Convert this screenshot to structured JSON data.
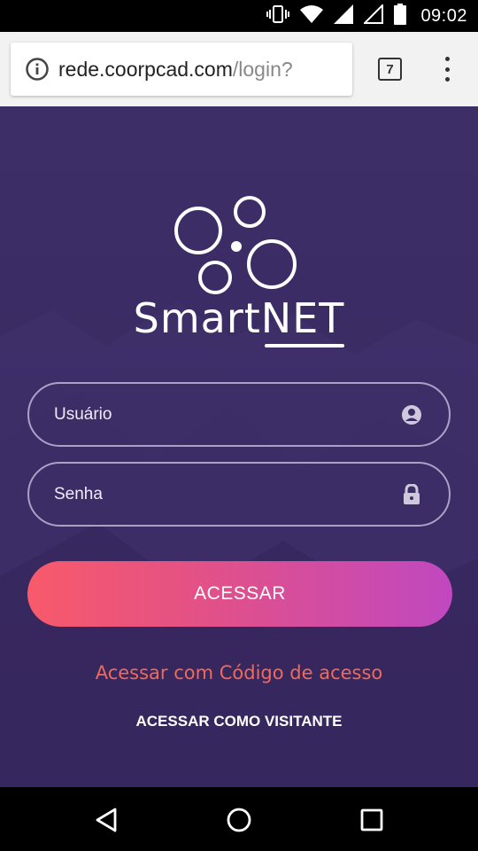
{
  "status_bar": {
    "time": "09:02",
    "icons": [
      "vibrate-icon",
      "wifi-icon",
      "signal-icon",
      "signal-empty-icon",
      "battery-icon"
    ]
  },
  "browser": {
    "url_host": "rede.coorpcad.com",
    "url_path": "/login?",
    "tab_count": "7"
  },
  "app": {
    "brand_prefix": "Smart",
    "brand_suffix": "NET",
    "username_placeholder": "Usuário",
    "password_placeholder": "Senha",
    "login_button": "ACESSAR",
    "access_code_link": "Acessar com Código de acesso",
    "guest_link": "ACESSAR COMO VISITANTE"
  },
  "colors": {
    "background": "#3a2b63",
    "button_gradient_start": "#f85a6a",
    "button_gradient_end": "#c048c0",
    "link_accent": "#f06a5a"
  },
  "nav_bar": {
    "icons": [
      "back-icon",
      "home-icon",
      "recents-icon"
    ]
  }
}
